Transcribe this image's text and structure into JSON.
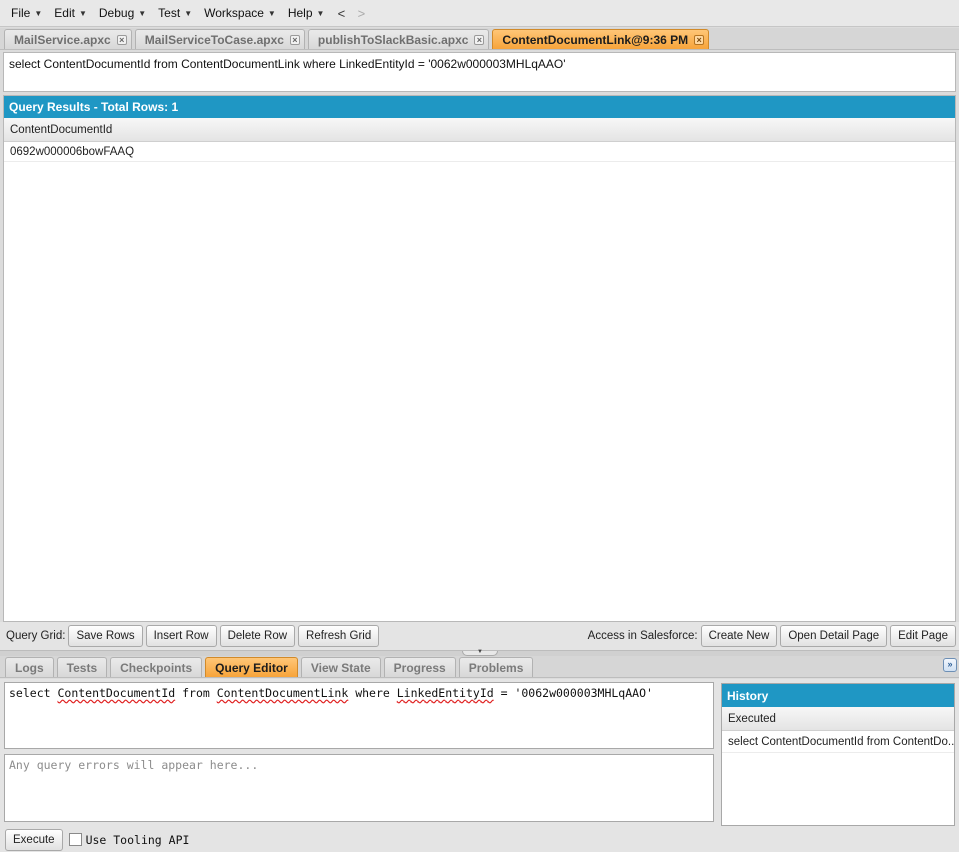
{
  "menu": {
    "items": [
      {
        "label": "File"
      },
      {
        "label": "Edit"
      },
      {
        "label": "Debug"
      },
      {
        "label": "Test"
      },
      {
        "label": "Workspace"
      },
      {
        "label": "Help"
      }
    ],
    "back": "<",
    "forward": ">"
  },
  "editor_tabs": [
    {
      "label": "MailService.apxc",
      "active": false
    },
    {
      "label": "MailServiceToCase.apxc",
      "active": false
    },
    {
      "label": "publishToSlackBasic.apxc",
      "active": false
    },
    {
      "label": "ContentDocumentLink@9:36 PM",
      "active": true
    }
  ],
  "tab_close_glyph": "×",
  "query_text": "select ContentDocumentId from ContentDocumentLink where LinkedEntityId = '0062w000003MHLqAAO'",
  "results": {
    "title": "Query Results - Total Rows: 1",
    "columns": [
      "ContentDocumentId"
    ],
    "rows": [
      [
        "0692w000006bowFAAQ"
      ]
    ]
  },
  "grid_toolbar": {
    "label": "Query Grid:",
    "save_rows": "Save Rows",
    "insert_row": "Insert Row",
    "delete_row": "Delete Row",
    "refresh_grid": "Refresh Grid",
    "access_label": "Access in Salesforce:",
    "create_new": "Create New",
    "open_detail_page": "Open Detail Page",
    "edit_page": "Edit Page"
  },
  "bottom_tabs": [
    {
      "label": "Logs",
      "active": false
    },
    {
      "label": "Tests",
      "active": false
    },
    {
      "label": "Checkpoints",
      "active": false
    },
    {
      "label": "Query Editor",
      "active": true
    },
    {
      "label": "View State",
      "active": false
    },
    {
      "label": "Progress",
      "active": false
    },
    {
      "label": "Problems",
      "active": false
    }
  ],
  "query_editor": {
    "kw_select": "select ",
    "field": "ContentDocumentId",
    "kw_from": " from ",
    "object": "ContentDocumentLink",
    "kw_where": " where ",
    "filter_field": "LinkedEntityId",
    "tail": " = '0062w000003MHLqAAO'"
  },
  "errors_placeholder": "Any query errors will appear here...",
  "history": {
    "title": "History",
    "column": "Executed",
    "rows": [
      "select ContentDocumentId from ContentDo..."
    ]
  },
  "execute": {
    "button": "Execute",
    "tooling_label": "Use Tooling API"
  },
  "colors": {
    "header_blue": "#1f97c4",
    "active_tab_orange": "#f7a43a"
  }
}
